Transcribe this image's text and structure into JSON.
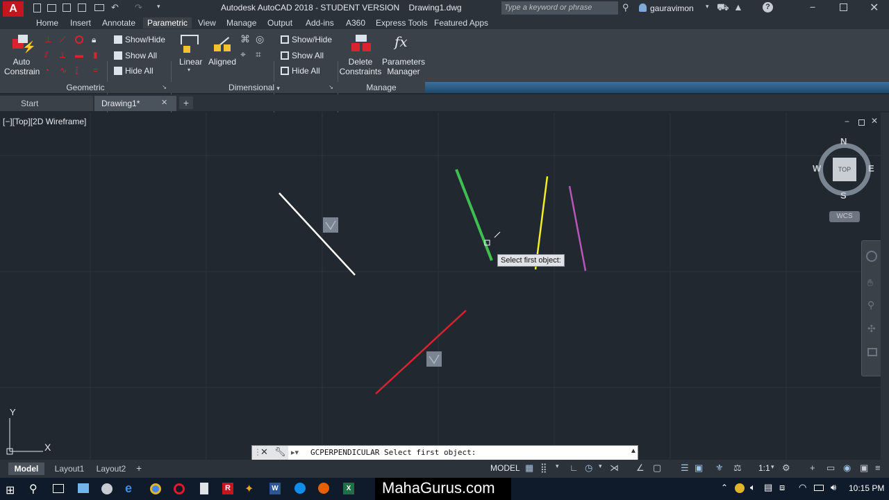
{
  "app": {
    "title": "Autodesk AutoCAD 2018 - STUDENT VERSION    Drawing1.dwg",
    "search_placeholder": "Type a keyword or phrase",
    "user": "gauravimon"
  },
  "ribbon_tabs": [
    "Home",
    "Insert",
    "Annotate",
    "Parametric",
    "View",
    "Manage",
    "Output",
    "Add-ins",
    "A360",
    "Express Tools",
    "Featured Apps"
  ],
  "ribbon": {
    "auto_constrain_line1": "Auto",
    "auto_constrain_line2": "Constrain",
    "geo_show_hide": "Show/Hide",
    "geo_show_all": "Show All",
    "geo_hide_all": "Hide All",
    "geometric_label": "Geometric",
    "linear": "Linear",
    "aligned": "Aligned",
    "dimensional_label": "Dimensional",
    "dim_show_hide": "Show/Hide",
    "dim_show_all": "Show All",
    "dim_hide_all": "Hide All",
    "delete_line1": "Delete",
    "delete_line2": "Constraints",
    "params_line1": "Parameters",
    "params_line2": "Manager",
    "manage_label": "Manage"
  },
  "doc_tabs": {
    "start": "Start",
    "drawing": "Drawing1*"
  },
  "viewport": {
    "label": "[−][Top][2D Wireframe]",
    "tooltip": "Select first object:",
    "viewcube": {
      "n": "N",
      "s": "S",
      "e": "E",
      "w": "W",
      "top": "TOP",
      "wcs": "WCS"
    },
    "ucs_x": "X",
    "ucs_y": "Y"
  },
  "command": {
    "text": "GCPERPENDICULAR Select first object:"
  },
  "layout_tabs": [
    "Model",
    "Layout1",
    "Layout2"
  ],
  "status": {
    "model": "MODEL",
    "scale": "1:1"
  },
  "taskbar": {
    "banner": "MahaGurus.com",
    "time": "10:15 PM"
  },
  "colors": {
    "canvas": "#212830",
    "line_white": "#ffffff",
    "line_green": "#3fbf4f",
    "line_yellow": "#f2ee2a",
    "line_magenta": "#b957b8",
    "line_red": "#d9232e"
  }
}
